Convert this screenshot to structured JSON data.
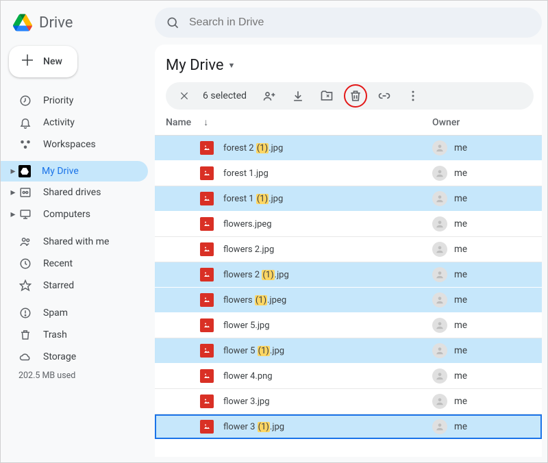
{
  "app_name": "Drive",
  "search_placeholder": "Search in Drive",
  "new_button_label": "New",
  "nav": {
    "priority": "Priority",
    "activity": "Activity",
    "workspaces": "Workspaces",
    "my_drive": "My Drive",
    "shared_drives": "Shared drives",
    "computers": "Computers",
    "shared_with_me": "Shared with me",
    "recent": "Recent",
    "starred": "Starred",
    "spam": "Spam",
    "trash": "Trash",
    "storage": "Storage"
  },
  "storage_used": "202.5 MB used",
  "main": {
    "title": "My Drive",
    "selected_count": "6 selected",
    "columns": {
      "name": "Name",
      "owner": "Owner"
    }
  },
  "files": [
    {
      "name_pre": "forest 2 ",
      "dup": "(1)",
      "name_post": ".jpg",
      "owner": "me",
      "selected": true
    },
    {
      "name_pre": "forest 1.jpg",
      "dup": "",
      "name_post": "",
      "owner": "me",
      "selected": false
    },
    {
      "name_pre": "forest 1 ",
      "dup": "(1)",
      "name_post": ".jpg",
      "owner": "me",
      "selected": true
    },
    {
      "name_pre": "flowers.jpeg",
      "dup": "",
      "name_post": "",
      "owner": "me",
      "selected": false
    },
    {
      "name_pre": "flowers 2.jpg",
      "dup": "",
      "name_post": "",
      "owner": "me",
      "selected": false
    },
    {
      "name_pre": "flowers 2 ",
      "dup": "(1)",
      "name_post": ".jpg",
      "owner": "me",
      "selected": true
    },
    {
      "name_pre": "flowers ",
      "dup": "(1)",
      "name_post": ".jpeg",
      "owner": "me",
      "selected": true
    },
    {
      "name_pre": "flower 5.jpg",
      "dup": "",
      "name_post": "",
      "owner": "me",
      "selected": false
    },
    {
      "name_pre": "flower 5 ",
      "dup": "(1)",
      "name_post": ".jpg",
      "owner": "me",
      "selected": true
    },
    {
      "name_pre": "flower 4.png",
      "dup": "",
      "name_post": "",
      "owner": "me",
      "selected": false
    },
    {
      "name_pre": "flower 3.jpg",
      "dup": "",
      "name_post": "",
      "owner": "me",
      "selected": false
    },
    {
      "name_pre": "flower 3 ",
      "dup": "(1)",
      "name_post": ".jpg",
      "owner": "me",
      "selected": true,
      "focused": true
    }
  ]
}
